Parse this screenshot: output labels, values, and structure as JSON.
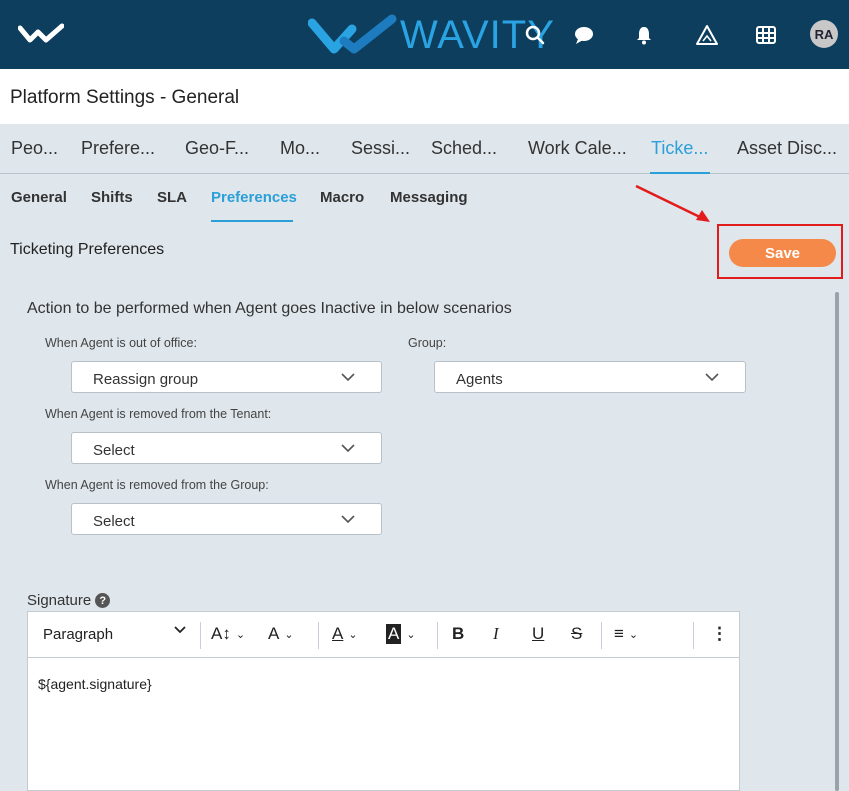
{
  "header": {
    "brand_name": "WAVITY",
    "brand_color": "#2aa3e3",
    "bar_color": "#0d3e5e",
    "avatar_initials": "RA",
    "icons": [
      "search-icon",
      "chat-icon",
      "bell-icon",
      "alert-triangle-icon",
      "grid-icon"
    ]
  },
  "page": {
    "title": "Platform Settings - General"
  },
  "main_tabs": [
    {
      "label": "Peo..."
    },
    {
      "label": "Prefere..."
    },
    {
      "label": "Geo-F..."
    },
    {
      "label": "Mo..."
    },
    {
      "label": "Sessi..."
    },
    {
      "label": "Sched..."
    },
    {
      "label": "Work Cale..."
    },
    {
      "label": "Ticke...",
      "active": true
    },
    {
      "label": "Asset Disc..."
    }
  ],
  "sub_tabs": [
    {
      "label": "General"
    },
    {
      "label": "Shifts"
    },
    {
      "label": "SLA"
    },
    {
      "label": "Preferences",
      "active": true
    },
    {
      "label": "Macro"
    },
    {
      "label": "Messaging"
    }
  ],
  "section": {
    "title": "Ticketing Preferences",
    "save_label": "Save",
    "save_color": "#f5894a"
  },
  "scenarios": {
    "heading": "Action to be performed when Agent goes Inactive in below scenarios",
    "out_of_office": {
      "label": "When Agent is out of office:",
      "value": "Reassign group"
    },
    "group": {
      "label": "Group:",
      "value": "Agents"
    },
    "removed_tenant": {
      "label": "When Agent is removed from the Tenant:",
      "value": "Select"
    },
    "removed_group": {
      "label": "When Agent is removed from the Group:",
      "value": "Select"
    }
  },
  "signature": {
    "label": "Signature",
    "help": "?",
    "toolbar": {
      "paragraph": "Paragraph",
      "font_size": "A↕",
      "font_family": "A",
      "font_color": "A",
      "bg_color": "A",
      "bold": "B",
      "italic": "I",
      "underline": "U",
      "strike": "S",
      "align": "≡",
      "more": "⋮"
    },
    "content": "${agent.signature}"
  }
}
